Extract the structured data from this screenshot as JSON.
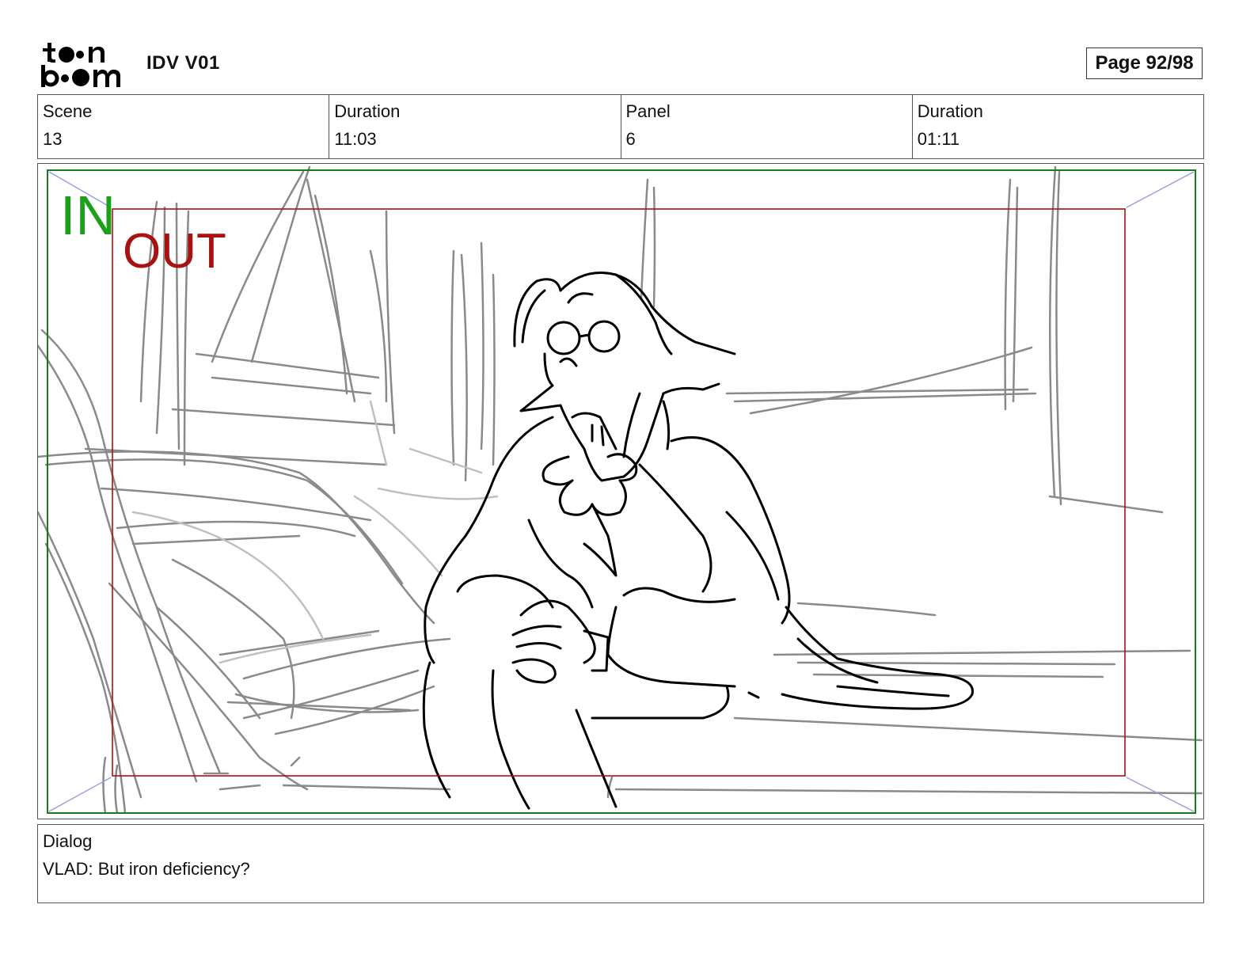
{
  "header": {
    "logo_text": "toon boom",
    "project_title": "IDV V01",
    "page_label": "Page 92/98"
  },
  "info": {
    "scene_label": "Scene",
    "scene_value": "13",
    "scene_duration_label": "Duration",
    "scene_duration_value": "11:03",
    "panel_label": "Panel",
    "panel_value": "6",
    "panel_duration_label": "Duration",
    "panel_duration_value": "01:11"
  },
  "frame": {
    "in_label": "IN",
    "out_label": "OUT",
    "in_color": "#1aa01a",
    "out_color": "#aa1111"
  },
  "dialog": {
    "label": "Dialog",
    "text": "VLAD: But iron deficiency?"
  }
}
